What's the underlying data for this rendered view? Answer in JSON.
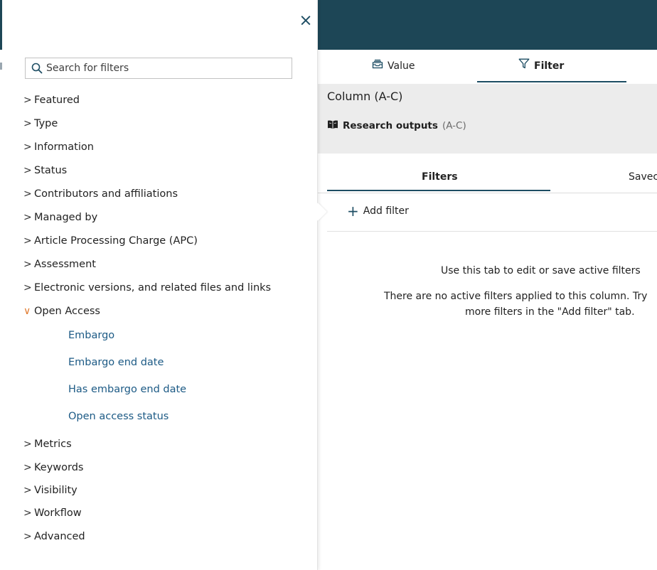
{
  "filter_panel": {
    "close_symbol": "×",
    "search": {
      "placeholder": "Search for filters",
      "value": ""
    },
    "categories": [
      {
        "label": "Featured",
        "chevron": ">"
      },
      {
        "label": "Type",
        "chevron": ">"
      },
      {
        "label": "Information",
        "chevron": ">"
      },
      {
        "label": "Status",
        "chevron": ">"
      },
      {
        "label": "Contributors and affiliations",
        "chevron": ">"
      },
      {
        "label": "Managed by",
        "chevron": ">"
      },
      {
        "label": "Article Processing Charge (APC)",
        "chevron": ">"
      },
      {
        "label": "Assessment",
        "chevron": ">"
      },
      {
        "label": "Electronic versions, and related files and links",
        "chevron": ">"
      },
      {
        "label": "Open Access",
        "chevron": "∨"
      },
      {
        "label": "Metrics",
        "chevron": ">"
      },
      {
        "label": "Keywords",
        "chevron": ">"
      },
      {
        "label": "Visibility",
        "chevron": ">"
      },
      {
        "label": "Workflow",
        "chevron": ">"
      },
      {
        "label": "Advanced",
        "chevron": ">"
      }
    ],
    "open_access_items": [
      "Embargo",
      "Embargo end date",
      "Has embargo end date",
      "Open access status"
    ]
  },
  "editor": {
    "tabs": {
      "value": "Value",
      "filter": "Filter"
    },
    "column": {
      "title": "Column (A-C)",
      "source_name": "Research outputs",
      "source_range": "(A-C)"
    },
    "subtabs": {
      "filters": "Filters",
      "saved": "Savec"
    },
    "add_filter_label": "Add filter",
    "message": {
      "line1": "Use this tab to edit or save active filters",
      "line2": "There are no active filters applied to this column. Try",
      "line3": "more filters in the \"Add filter\" tab."
    }
  },
  "colors": {
    "accent": "#1d4656",
    "link": "#1c5a85",
    "chevron_open": "#e07a2e"
  }
}
